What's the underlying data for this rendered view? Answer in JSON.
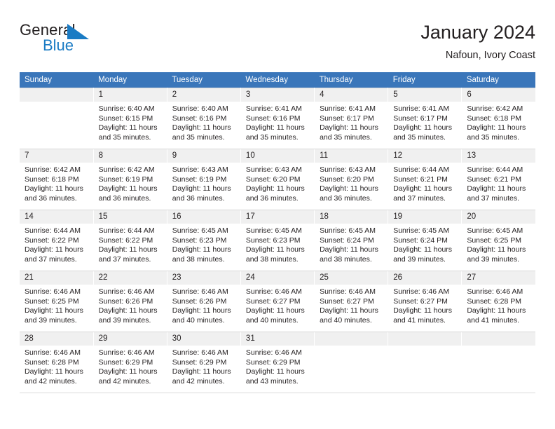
{
  "brand": {
    "name_part1": "General",
    "name_part2": "Blue",
    "accent_color": "#1a7bc4",
    "logo_icon": "triangle-flag-icon"
  },
  "header": {
    "title": "January 2024",
    "subtitle": "Nafoun, Ivory Coast",
    "header_bg_color": "#3a76ba",
    "daynum_bg_color": "#f0f0f0"
  },
  "weekday_headers": [
    "Sunday",
    "Monday",
    "Tuesday",
    "Wednesday",
    "Thursday",
    "Friday",
    "Saturday"
  ],
  "weeks": [
    [
      {
        "day": "",
        "empty": true
      },
      {
        "day": "1",
        "sunrise": "Sunrise: 6:40 AM",
        "sunset": "Sunset: 6:15 PM",
        "daylight_line1": "Daylight: 11 hours",
        "daylight_line2": "and 35 minutes."
      },
      {
        "day": "2",
        "sunrise": "Sunrise: 6:40 AM",
        "sunset": "Sunset: 6:16 PM",
        "daylight_line1": "Daylight: 11 hours",
        "daylight_line2": "and 35 minutes."
      },
      {
        "day": "3",
        "sunrise": "Sunrise: 6:41 AM",
        "sunset": "Sunset: 6:16 PM",
        "daylight_line1": "Daylight: 11 hours",
        "daylight_line2": "and 35 minutes."
      },
      {
        "day": "4",
        "sunrise": "Sunrise: 6:41 AM",
        "sunset": "Sunset: 6:17 PM",
        "daylight_line1": "Daylight: 11 hours",
        "daylight_line2": "and 35 minutes."
      },
      {
        "day": "5",
        "sunrise": "Sunrise: 6:41 AM",
        "sunset": "Sunset: 6:17 PM",
        "daylight_line1": "Daylight: 11 hours",
        "daylight_line2": "and 35 minutes."
      },
      {
        "day": "6",
        "sunrise": "Sunrise: 6:42 AM",
        "sunset": "Sunset: 6:18 PM",
        "daylight_line1": "Daylight: 11 hours",
        "daylight_line2": "and 35 minutes."
      }
    ],
    [
      {
        "day": "7",
        "sunrise": "Sunrise: 6:42 AM",
        "sunset": "Sunset: 6:18 PM",
        "daylight_line1": "Daylight: 11 hours",
        "daylight_line2": "and 36 minutes."
      },
      {
        "day": "8",
        "sunrise": "Sunrise: 6:42 AM",
        "sunset": "Sunset: 6:19 PM",
        "daylight_line1": "Daylight: 11 hours",
        "daylight_line2": "and 36 minutes."
      },
      {
        "day": "9",
        "sunrise": "Sunrise: 6:43 AM",
        "sunset": "Sunset: 6:19 PM",
        "daylight_line1": "Daylight: 11 hours",
        "daylight_line2": "and 36 minutes."
      },
      {
        "day": "10",
        "sunrise": "Sunrise: 6:43 AM",
        "sunset": "Sunset: 6:20 PM",
        "daylight_line1": "Daylight: 11 hours",
        "daylight_line2": "and 36 minutes."
      },
      {
        "day": "11",
        "sunrise": "Sunrise: 6:43 AM",
        "sunset": "Sunset: 6:20 PM",
        "daylight_line1": "Daylight: 11 hours",
        "daylight_line2": "and 36 minutes."
      },
      {
        "day": "12",
        "sunrise": "Sunrise: 6:44 AM",
        "sunset": "Sunset: 6:21 PM",
        "daylight_line1": "Daylight: 11 hours",
        "daylight_line2": "and 37 minutes."
      },
      {
        "day": "13",
        "sunrise": "Sunrise: 6:44 AM",
        "sunset": "Sunset: 6:21 PM",
        "daylight_line1": "Daylight: 11 hours",
        "daylight_line2": "and 37 minutes."
      }
    ],
    [
      {
        "day": "14",
        "sunrise": "Sunrise: 6:44 AM",
        "sunset": "Sunset: 6:22 PM",
        "daylight_line1": "Daylight: 11 hours",
        "daylight_line2": "and 37 minutes."
      },
      {
        "day": "15",
        "sunrise": "Sunrise: 6:44 AM",
        "sunset": "Sunset: 6:22 PM",
        "daylight_line1": "Daylight: 11 hours",
        "daylight_line2": "and 37 minutes."
      },
      {
        "day": "16",
        "sunrise": "Sunrise: 6:45 AM",
        "sunset": "Sunset: 6:23 PM",
        "daylight_line1": "Daylight: 11 hours",
        "daylight_line2": "and 38 minutes."
      },
      {
        "day": "17",
        "sunrise": "Sunrise: 6:45 AM",
        "sunset": "Sunset: 6:23 PM",
        "daylight_line1": "Daylight: 11 hours",
        "daylight_line2": "and 38 minutes."
      },
      {
        "day": "18",
        "sunrise": "Sunrise: 6:45 AM",
        "sunset": "Sunset: 6:24 PM",
        "daylight_line1": "Daylight: 11 hours",
        "daylight_line2": "and 38 minutes."
      },
      {
        "day": "19",
        "sunrise": "Sunrise: 6:45 AM",
        "sunset": "Sunset: 6:24 PM",
        "daylight_line1": "Daylight: 11 hours",
        "daylight_line2": "and 39 minutes."
      },
      {
        "day": "20",
        "sunrise": "Sunrise: 6:45 AM",
        "sunset": "Sunset: 6:25 PM",
        "daylight_line1": "Daylight: 11 hours",
        "daylight_line2": "and 39 minutes."
      }
    ],
    [
      {
        "day": "21",
        "sunrise": "Sunrise: 6:46 AM",
        "sunset": "Sunset: 6:25 PM",
        "daylight_line1": "Daylight: 11 hours",
        "daylight_line2": "and 39 minutes."
      },
      {
        "day": "22",
        "sunrise": "Sunrise: 6:46 AM",
        "sunset": "Sunset: 6:26 PM",
        "daylight_line1": "Daylight: 11 hours",
        "daylight_line2": "and 39 minutes."
      },
      {
        "day": "23",
        "sunrise": "Sunrise: 6:46 AM",
        "sunset": "Sunset: 6:26 PM",
        "daylight_line1": "Daylight: 11 hours",
        "daylight_line2": "and 40 minutes."
      },
      {
        "day": "24",
        "sunrise": "Sunrise: 6:46 AM",
        "sunset": "Sunset: 6:27 PM",
        "daylight_line1": "Daylight: 11 hours",
        "daylight_line2": "and 40 minutes."
      },
      {
        "day": "25",
        "sunrise": "Sunrise: 6:46 AM",
        "sunset": "Sunset: 6:27 PM",
        "daylight_line1": "Daylight: 11 hours",
        "daylight_line2": "and 40 minutes."
      },
      {
        "day": "26",
        "sunrise": "Sunrise: 6:46 AM",
        "sunset": "Sunset: 6:27 PM",
        "daylight_line1": "Daylight: 11 hours",
        "daylight_line2": "and 41 minutes."
      },
      {
        "day": "27",
        "sunrise": "Sunrise: 6:46 AM",
        "sunset": "Sunset: 6:28 PM",
        "daylight_line1": "Daylight: 11 hours",
        "daylight_line2": "and 41 minutes."
      }
    ],
    [
      {
        "day": "28",
        "sunrise": "Sunrise: 6:46 AM",
        "sunset": "Sunset: 6:28 PM",
        "daylight_line1": "Daylight: 11 hours",
        "daylight_line2": "and 42 minutes."
      },
      {
        "day": "29",
        "sunrise": "Sunrise: 6:46 AM",
        "sunset": "Sunset: 6:29 PM",
        "daylight_line1": "Daylight: 11 hours",
        "daylight_line2": "and 42 minutes."
      },
      {
        "day": "30",
        "sunrise": "Sunrise: 6:46 AM",
        "sunset": "Sunset: 6:29 PM",
        "daylight_line1": "Daylight: 11 hours",
        "daylight_line2": "and 42 minutes."
      },
      {
        "day": "31",
        "sunrise": "Sunrise: 6:46 AM",
        "sunset": "Sunset: 6:29 PM",
        "daylight_line1": "Daylight: 11 hours",
        "daylight_line2": "and 43 minutes."
      },
      {
        "day": "",
        "empty": true
      },
      {
        "day": "",
        "empty": true
      },
      {
        "day": "",
        "empty": true
      }
    ]
  ]
}
